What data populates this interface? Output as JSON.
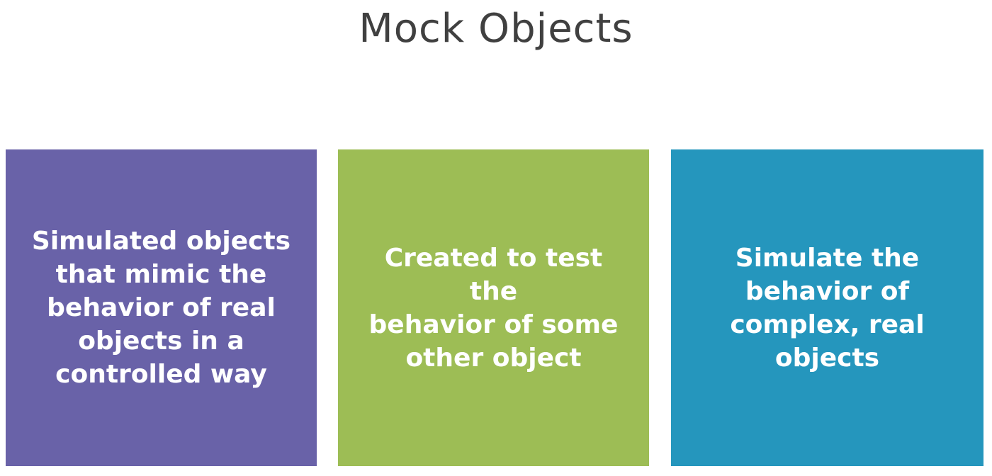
{
  "slide": {
    "title": "Mock Objects"
  },
  "cards": [
    {
      "text": "Simulated objects\nthat mimic the\nbehavior of real\nobjects in a\ncontrolled way",
      "color": "#6962a8"
    },
    {
      "text": "Created to test the\nbehavior of some\nother object",
      "color": "#9dbd55"
    },
    {
      "text": "Simulate the\nbehavior of\ncomplex, real\nobjects",
      "color": "#2596bd"
    }
  ]
}
